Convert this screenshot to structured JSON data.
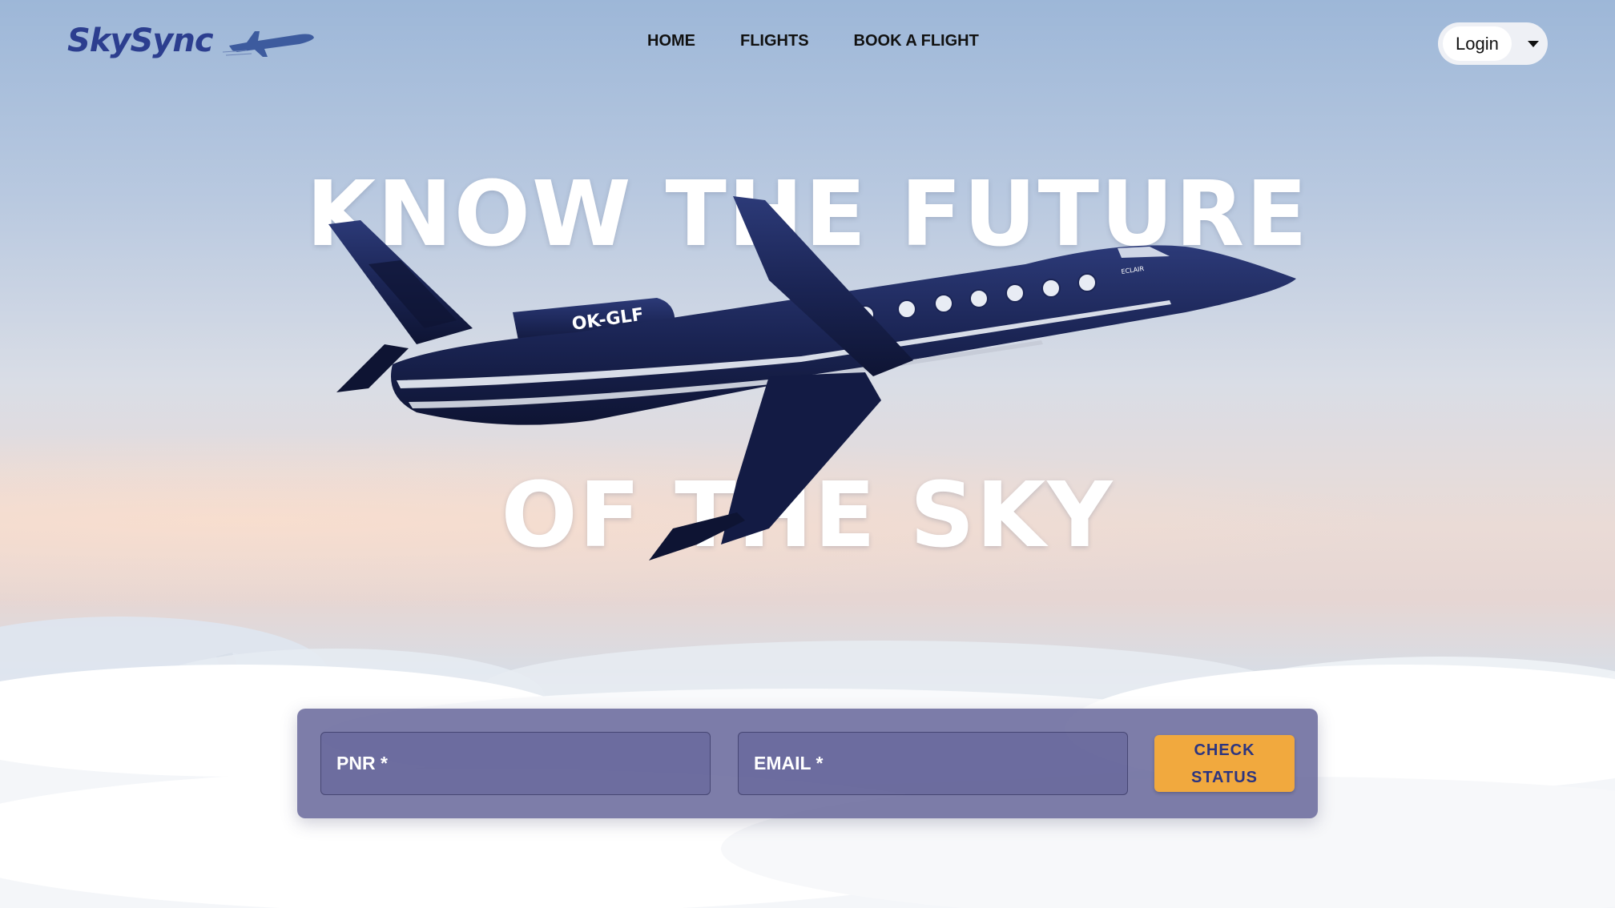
{
  "brand": {
    "name": "SkySync",
    "color": "#2c3e8f"
  },
  "nav": {
    "links": [
      {
        "label": "HOME"
      },
      {
        "label": "FLIGHTS"
      },
      {
        "label": "BOOK A FLIGHT"
      }
    ],
    "login_label": "Login"
  },
  "hero": {
    "line1": "KNOW THE FUTURE",
    "line2": "OF THE SKY"
  },
  "jet": {
    "registration": "OK-GLF",
    "name": "ECLAIR",
    "body_color": "#1b2555"
  },
  "status_form": {
    "pnr_label": "PNR *",
    "email_label": "EMAIL *",
    "button_line1": "CHECK",
    "button_line2": "STATUS",
    "button_color": "#f1a93e",
    "panel_color": "#6060a0"
  }
}
